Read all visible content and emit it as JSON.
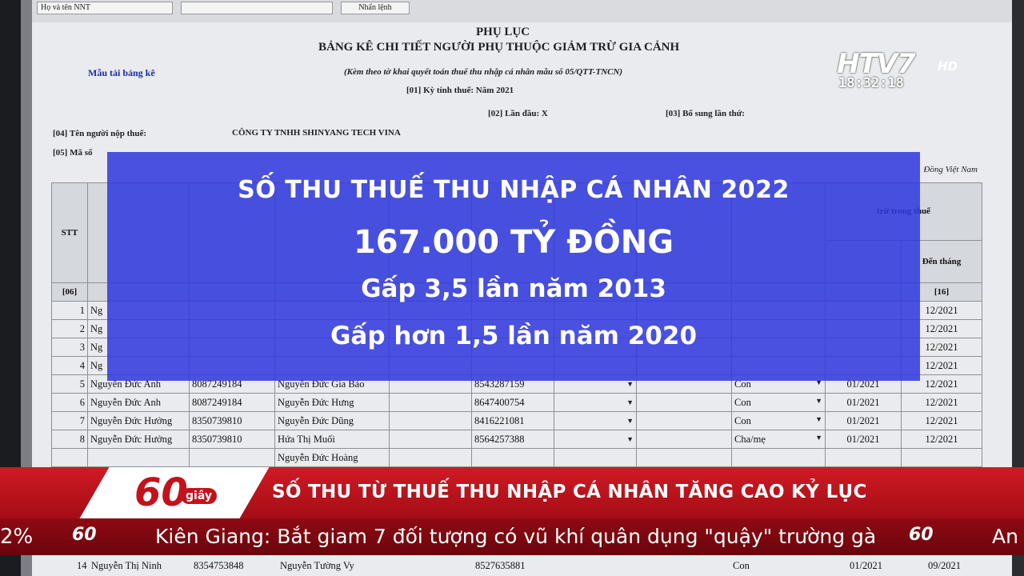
{
  "document": {
    "top_field_1": "Họ và tên NNT",
    "top_button": "Nhấn lệnh",
    "title": "PHỤ LỤC",
    "subtitle": "BẢNG KÊ CHI TIẾT NGƯỜI PHỤ THUỘC GIẢM TRỪ GIA CẢNH",
    "attachment_note": "(Kèm theo tờ khai quyết toán thuế thu nhập cá nhân mẫu số 05/QTT-TNCN)",
    "template_link": "Mẫu tải bảng kê",
    "tax_period": "[01]   Kỳ tính thuế:   Năm 2021",
    "first_time": "[02] Lần đầu:   X",
    "supplement": "[03] Bổ sung lần thứ:",
    "taxpayer_name_label": "[04]  Tên người nộp thuế:",
    "taxpayer_name": "CÔNG TY TNHH SHINYANG TECH VINA",
    "tax_code_label": "[05]  Mã số",
    "currency": "Đồng Việt Nam",
    "header": {
      "stt": "STT",
      "deduction_period": "trừ trong thuế",
      "to_month": "Đến tháng",
      "col_06": "[06]",
      "col_16": "[16]"
    },
    "rows": [
      {
        "stt": "1",
        "name": "Ng",
        "end": "12/2021"
      },
      {
        "stt": "2",
        "name": "Ng",
        "end": "12/2021"
      },
      {
        "stt": "3",
        "name": "Ng",
        "end": "12/2021"
      },
      {
        "stt": "4",
        "name": "Ng",
        "end": "12/2021"
      },
      {
        "stt": "5",
        "name": "Nguyễn Đức Anh",
        "mst": "8087249184",
        "dep": "Nguyễn Đức Gia Bảo",
        "dep_mst": "8543287159",
        "rel": "Con",
        "start": "01/2021",
        "end": "12/2021"
      },
      {
        "stt": "6",
        "name": "Nguyễn Đức Anh",
        "mst": "8087249184",
        "dep": "Nguyễn Đức Hưng",
        "dep_mst": "8647400754",
        "rel": "Con",
        "start": "01/2021",
        "end": "12/2021"
      },
      {
        "stt": "7",
        "name": "Nguyễn Đức Hưởng",
        "mst": "8350739810",
        "dep": "Nguyễn Đức Dũng",
        "dep_mst": "8416221081",
        "rel": "Con",
        "start": "01/2021",
        "end": "12/2021"
      },
      {
        "stt": "8",
        "name": "Nguyễn Đức Hưởng",
        "mst": "8350739810",
        "dep": "Hứa Thị Muối",
        "dep_mst": "8564257388",
        "rel": "Cha/mẹ",
        "start": "01/2021",
        "end": "12/2021"
      }
    ],
    "partial_row_dep": "Nguyễn Đức Hoàng",
    "bottom_row": {
      "stt": "14",
      "name": "Nguyễn Thị Ninh",
      "mst": "8354753848",
      "dep": "Nguyễn Tường Vy",
      "dep_mst": "8527635881",
      "rel": "Con",
      "start": "01/2021",
      "end": "09/2021"
    }
  },
  "overlay": {
    "line1": "SỐ THU THUẾ THU NHẬP CÁ NHÂN 2022",
    "line2": "167.000 TỶ ĐỒNG",
    "line3": "Gấp 3,5 lần năm 2013",
    "line4": "Gấp hơn 1,5 lần năm 2020"
  },
  "channel": {
    "logo": "HTV7",
    "hd": "HD",
    "time": "18:32:18"
  },
  "program": {
    "name": "60",
    "unit": "giây"
  },
  "headline": "SỐ THU TỪ THUẾ THU NHẬP CÁ NHÂN TĂNG CAO KỶ LỤC",
  "ticker": {
    "left_fragment": "2%",
    "mini_logo": "60",
    "text": "Kiên Giang: Bắt giam 7 đối tượng có vũ khí quân dụng \"quậy\" trường gà",
    "right_fragment": "An"
  }
}
